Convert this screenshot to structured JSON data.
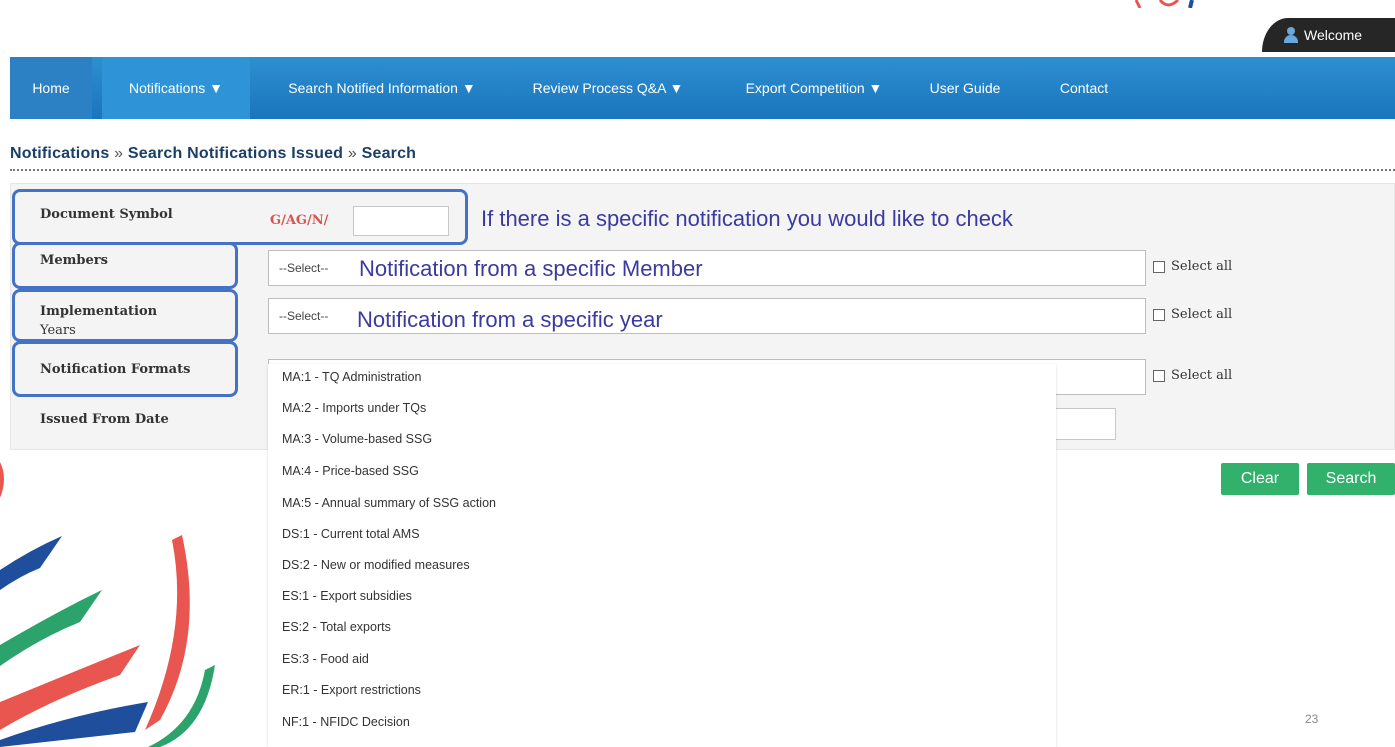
{
  "header": {
    "welcome": "Welcome"
  },
  "nav": {
    "items": [
      "Home",
      "Notifications ▼",
      "Search Notified Information ▼",
      "Review Process Q&A ▼",
      "Export Competition ▼",
      "User Guide",
      "Contact"
    ]
  },
  "breadcrumb": {
    "part1": "Notifications",
    "part2": "Search Notifications Issued",
    "part3": "Search",
    "sep": "»"
  },
  "form": {
    "document_symbol_label": "Document Symbol",
    "document_symbol_prefix": "G/AG/N/",
    "document_symbol_value": "",
    "members_label": "Members",
    "members_value": "--Select--",
    "years_label_1": "Implementation",
    "years_label_2": "Years",
    "years_value": "--Select--",
    "formats_label": "Notification Formats",
    "formats_value": "MA:1 - TQ Administration",
    "issued_from_label": "Issued From Date",
    "select_all": "Select all"
  },
  "annotations": {
    "doc": "If there is a specific notification you would like to check",
    "member": "Notification from a specific Member",
    "year": "Notification from a specific year"
  },
  "dropdown": {
    "options": [
      "MA:1 - TQ Administration",
      "MA:2 - Imports under TQs",
      "MA:3 - Volume-based SSG",
      "MA:4 - Price-based SSG",
      "MA:5 - Annual summary of SSG action",
      "DS:1 - Current total AMS",
      "DS:2 - New or modified measures",
      "ES:1 - Export subsidies",
      "ES:2 - Total exports",
      "ES:3 - Food aid",
      "ER:1 - Export restrictions",
      "NF:1 - NFIDC Decision"
    ]
  },
  "buttons": {
    "clear": "Clear",
    "search": "Search"
  },
  "slide": {
    "page_number": "23"
  },
  "colors": {
    "nav_bg": "#1a75bd",
    "highlight": "#4472c4",
    "annotation_text": "#3b3aa0",
    "button_green": "#31b16b",
    "prefix_red": "#d9534f"
  }
}
